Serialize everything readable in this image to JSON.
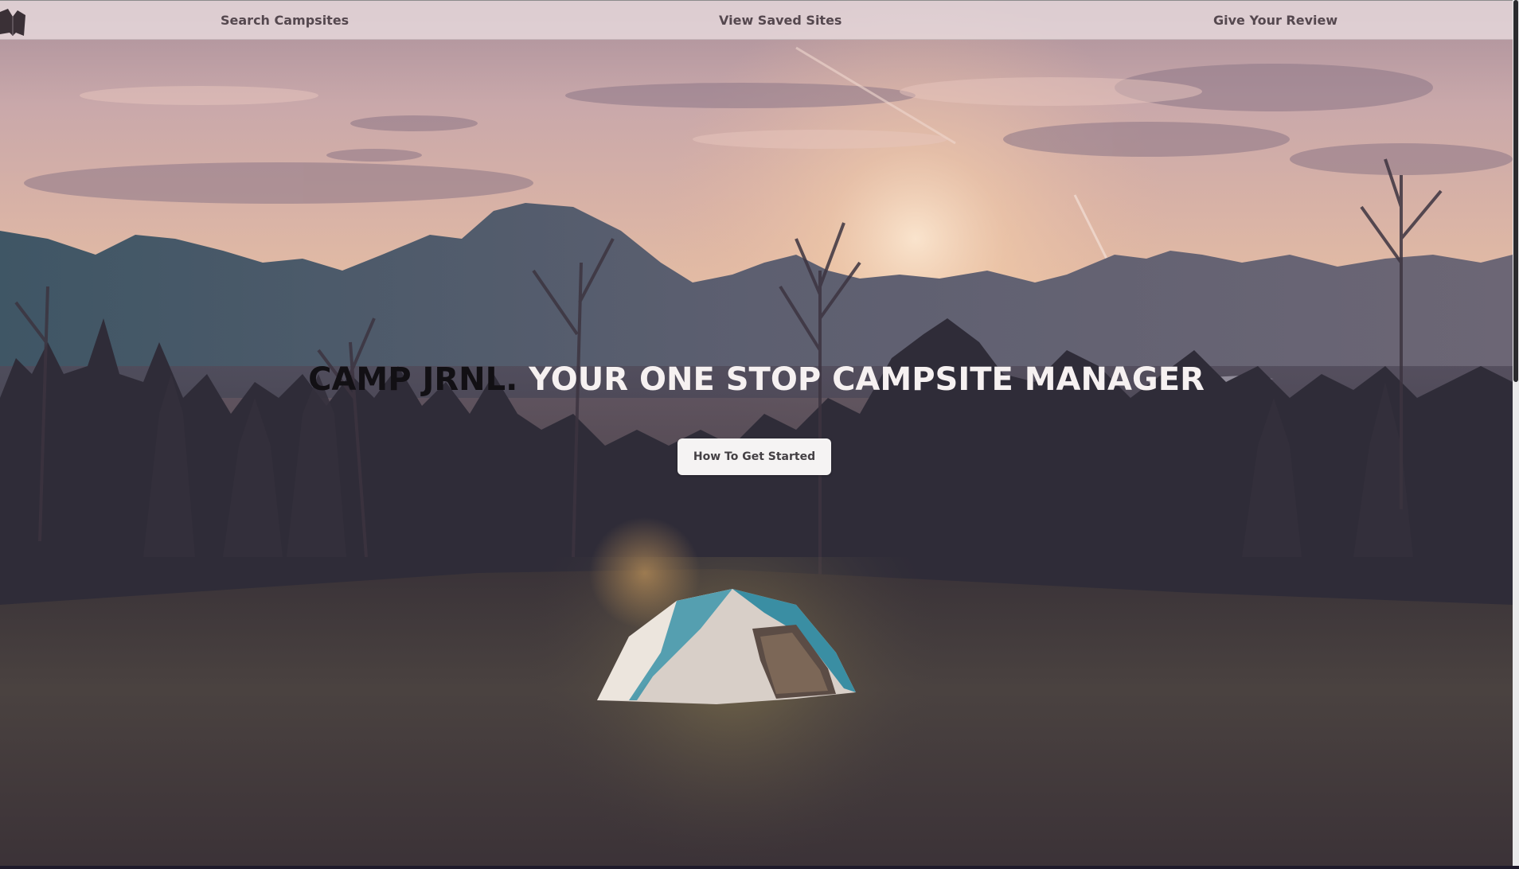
{
  "nav": {
    "links": [
      {
        "label": "Search Campsites"
      },
      {
        "label": "View Saved Sites"
      },
      {
        "label": "Give Your Review"
      }
    ],
    "logo_icon": "book-logo-icon"
  },
  "hero": {
    "brand": "CAMP JRNL.",
    "tagline": "YOUR ONE STOP CAMPSITE MANAGER",
    "cta_label": "How To Get Started",
    "background_image": "sunset-mountains-tent-photo"
  },
  "colors": {
    "nav_background": "#ebdee0",
    "nav_text": "#55484f",
    "brand_text": "#121014",
    "tagline_text": "#f6f1f1",
    "button_background": "#f5f3f3",
    "button_text": "#444044"
  }
}
